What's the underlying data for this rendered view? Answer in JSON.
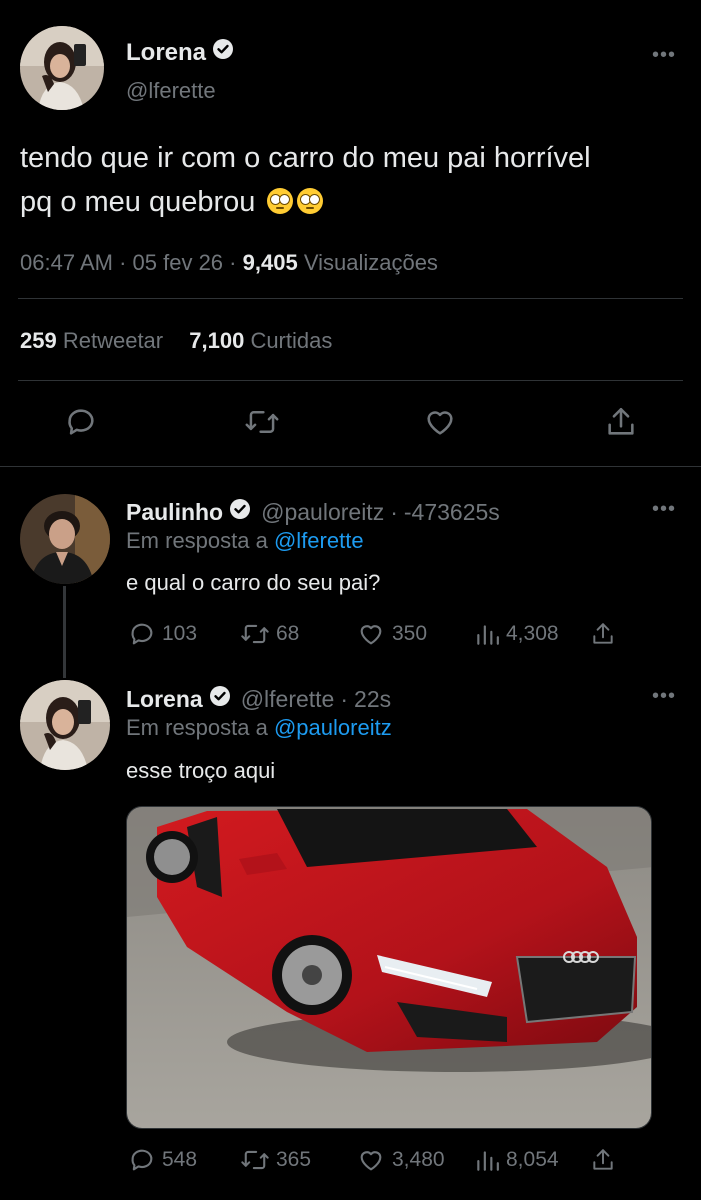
{
  "main_tweet": {
    "author_name": "Lorena",
    "author_handle": "@lferette",
    "text_line1": "tendo que ir com o carro do meu pai horrível",
    "text_line2": "pq o meu quebrou",
    "time": "06:47 AM",
    "date": "05 fev 26",
    "views": "9,405",
    "views_label": "Visualizações",
    "retweets": "259",
    "retweets_label": "Retweetar",
    "likes": "7,100",
    "likes_label": "Curtidas"
  },
  "reply1": {
    "author_name": "Paulinho",
    "author_handle": "@pauloreitz",
    "time": "-473625s",
    "reply_prefix": "Em resposta a",
    "reply_to": "@lferette",
    "text": "e qual o carro do seu pai?",
    "replies": "103",
    "retweets": "68",
    "likes": "350",
    "views": "4,308"
  },
  "reply2": {
    "author_name": "Lorena",
    "author_handle": "@lferette",
    "time": "22s",
    "reply_prefix": "Em resposta a",
    "reply_to": "@pauloreitz",
    "text": "esse troço aqui",
    "replies": "548",
    "retweets": "365",
    "likes": "3,480",
    "views": "8,054"
  },
  "icons": {
    "reply": "reply-icon",
    "retweet": "retweet-icon",
    "like": "heart-icon",
    "share": "share-icon",
    "views": "views-icon",
    "verified": "verified-badge-icon",
    "more": "more-icon"
  },
  "colors": {
    "background": "#000000",
    "text": "#e7e9ea",
    "muted": "#71767b",
    "link": "#1d9bf0",
    "divider": "#2f3336"
  }
}
